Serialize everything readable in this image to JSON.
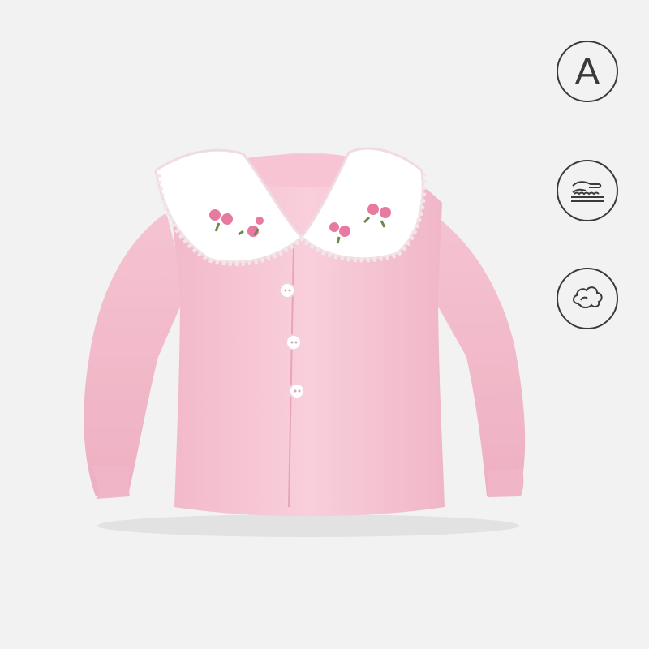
{
  "product": {
    "name_icon": "pink-baby-cardigan",
    "body_color": "#f6c9d6",
    "collar_color": "#ffffff",
    "accent_color": "#e77aa0"
  },
  "features": [
    {
      "icon": "letter-a-icon",
      "glyph": "A"
    },
    {
      "icon": "soft-fabric-hand-icon"
    },
    {
      "icon": "cloud-softness-icon"
    }
  ]
}
